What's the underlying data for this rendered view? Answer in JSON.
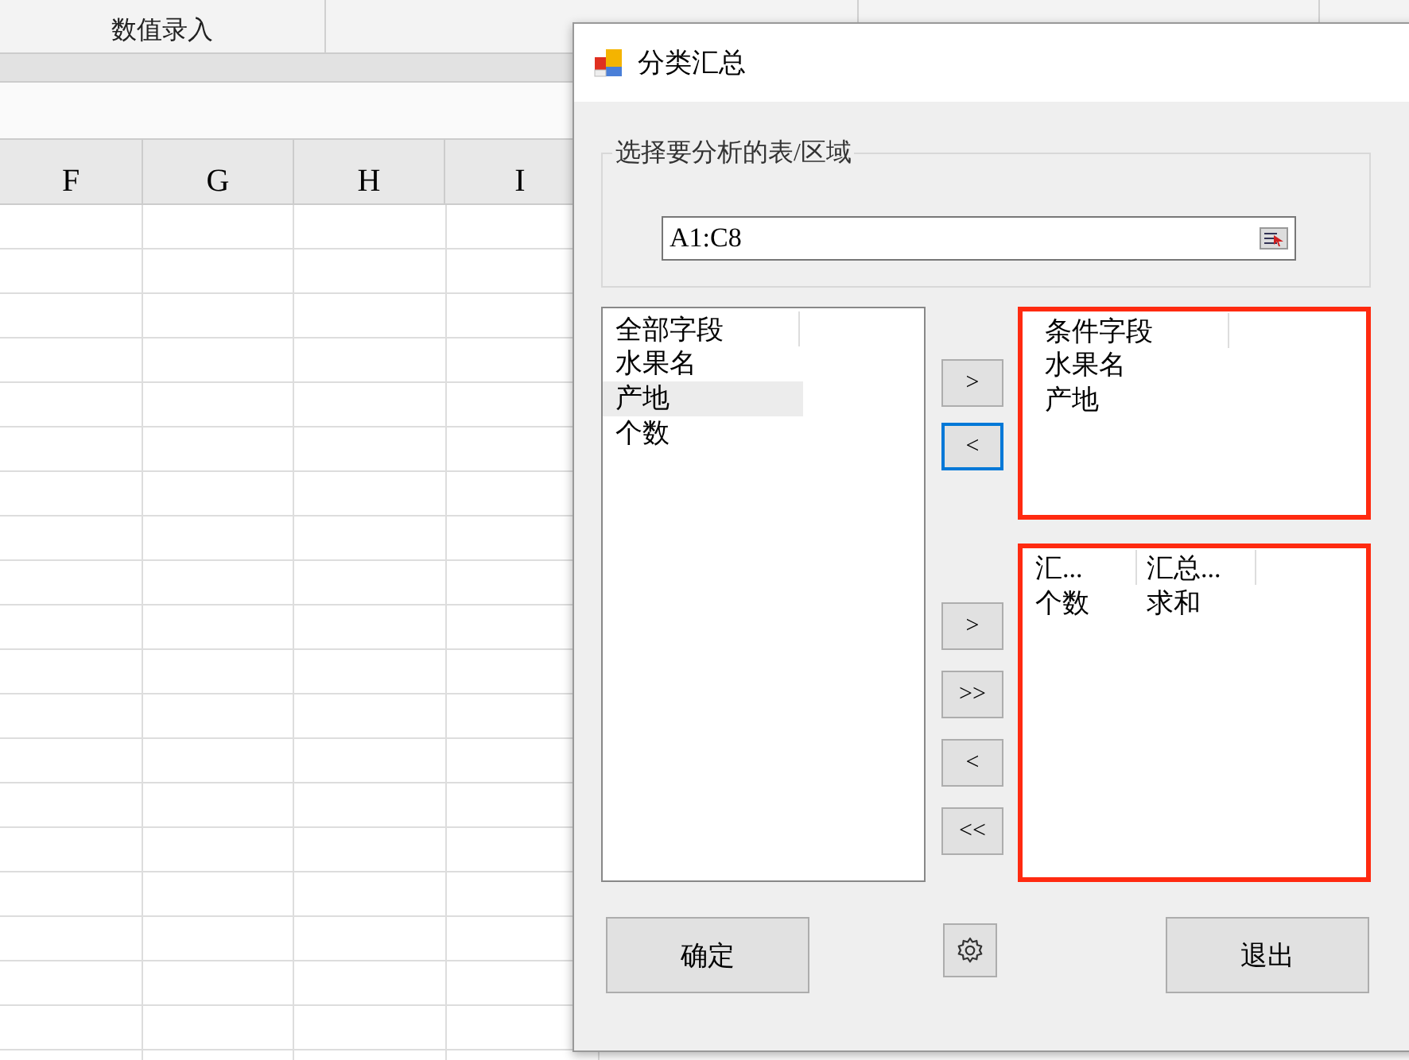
{
  "ribbon_tabs": [
    {
      "label": "数值录入"
    }
  ],
  "columns": [
    "F",
    "G",
    "H",
    "I"
  ],
  "dialog": {
    "title": "分类汇总",
    "range_group": {
      "legend": "选择要分析的表/区域",
      "value": "A1:C8"
    },
    "all_fields": {
      "header": "全部字段",
      "items": [
        {
          "label": "水果名",
          "selected": false
        },
        {
          "label": "产地",
          "selected": true
        },
        {
          "label": "个数",
          "selected": false
        }
      ]
    },
    "condition_fields": {
      "header": "条件字段",
      "highlighted": true,
      "items": [
        {
          "label": "水果名"
        },
        {
          "label": "产地"
        }
      ]
    },
    "summary_fields": {
      "highlighted": true,
      "columns": [
        "汇...",
        "汇总..."
      ],
      "rows": [
        [
          "个数",
          "求和"
        ]
      ]
    },
    "condition_buttons": [
      {
        "label": ">",
        "focused": false
      },
      {
        "label": "<",
        "focused": true
      }
    ],
    "summary_buttons": [
      {
        "label": ">",
        "focused": false
      },
      {
        "label": ">>",
        "focused": false
      },
      {
        "label": "<",
        "focused": false
      },
      {
        "label": "<<",
        "focused": false
      }
    ],
    "ok_button": "确定",
    "exit_button": "退出"
  }
}
